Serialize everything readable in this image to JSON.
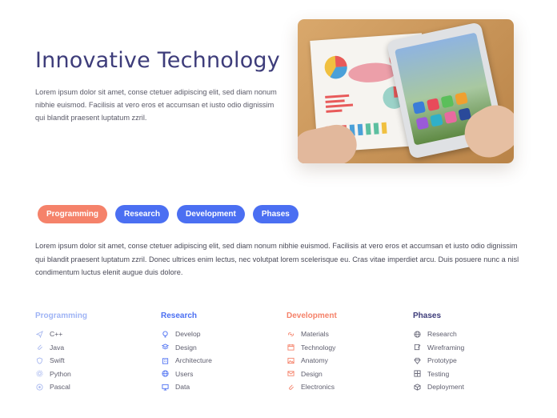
{
  "hero": {
    "title": "Innovative Technology",
    "text": "Lorem ipsum dolor sit amet, conse ctetuer adipiscing elit, sed diam nonum nibhie euismod. Facilisis at vero eros et accumsan et iusto odio dignissim qui blandit praesent luptatum zzril.",
    "image_alt": "tablet-and-infographic-photo"
  },
  "tabs": [
    {
      "label": "Programming",
      "active": true
    },
    {
      "label": "Research",
      "active": false
    },
    {
      "label": "Development",
      "active": false
    },
    {
      "label": "Phases",
      "active": false
    }
  ],
  "body_text": "Lorem ipsum dolor sit amet, conse ctetuer adipiscing elit, sed diam nonum nibhie euismod. Facilisis at vero eros et accumsan et iusto odio dignissim qui blandit praesent luptatum zzril. Donec ultrices enim lectus, nec volutpat lorem scelerisque eu. Cras vitae imperdiet arcu. Duis posuere nunc a nisl condimentum luctus elenit augue duis dolore.",
  "columns": [
    {
      "title": "Programming",
      "title_color": "#9fb4f5",
      "icon_color": "#a9b9f0",
      "items": [
        {
          "label": "C++",
          "icon": "send-icon"
        },
        {
          "label": "Java",
          "icon": "paperclip-icon"
        },
        {
          "label": "Swift",
          "icon": "shield-icon"
        },
        {
          "label": "Python",
          "icon": "gear-icon"
        },
        {
          "label": "Pascal",
          "icon": "target-icon"
        }
      ]
    },
    {
      "title": "Research",
      "title_color": "#4b6ff2",
      "icon_color": "#4b6ff2",
      "items": [
        {
          "label": "Develop",
          "icon": "bulb-icon"
        },
        {
          "label": "Design",
          "icon": "layers-icon"
        },
        {
          "label": "Architecture",
          "icon": "building-icon"
        },
        {
          "label": "Users",
          "icon": "globe-icon"
        },
        {
          "label": "Data",
          "icon": "monitor-icon"
        }
      ]
    },
    {
      "title": "Development",
      "title_color": "#f5826a",
      "icon_color": "#f5826a",
      "items": [
        {
          "label": "Materials",
          "icon": "link-icon"
        },
        {
          "label": "Technology",
          "icon": "calendar-icon"
        },
        {
          "label": "Anatomy",
          "icon": "image-icon"
        },
        {
          "label": "Design",
          "icon": "mail-icon"
        },
        {
          "label": "Electronics",
          "icon": "paperclip-icon"
        }
      ]
    },
    {
      "title": "Phases",
      "title_color": "#3d3c7a",
      "icon_color": "#6a6a7a",
      "items": [
        {
          "label": "Research",
          "icon": "globe-icon"
        },
        {
          "label": "Wireframing",
          "icon": "edit-icon"
        },
        {
          "label": "Prototype",
          "icon": "diamond-icon"
        },
        {
          "label": "Testing",
          "icon": "grid-icon"
        },
        {
          "label": "Deployment",
          "icon": "box-icon"
        }
      ]
    }
  ]
}
